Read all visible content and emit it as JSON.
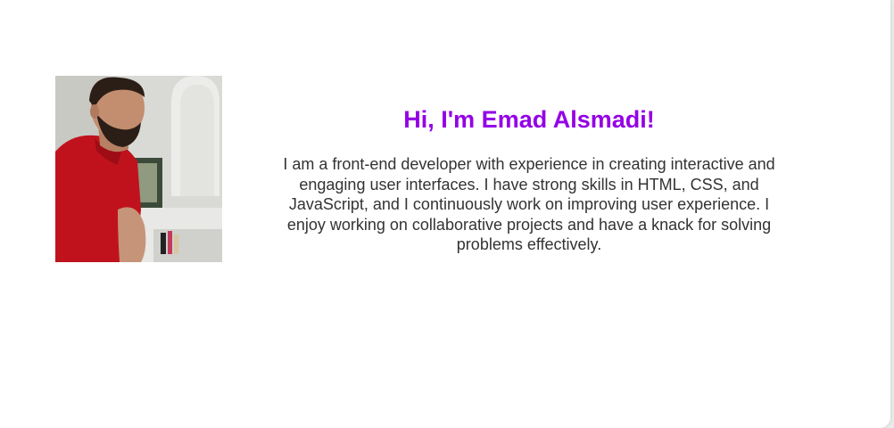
{
  "profile": {
    "photo_icon": "profile-photo",
    "greeting": "Hi, I'm Emad Alsmadi!",
    "bio": "I am a front-end developer with experience in creating interactive and engaging user interfaces. I have strong skills in HTML, CSS, and JavaScript, and I continuously work on improving user experience. I enjoy working on collaborative projects and have a knack for solving problems effectively."
  },
  "colors": {
    "page_background": "#ffffff",
    "outer_background": "#ebebeb",
    "heading": "#9400e6",
    "body_text": "#333333"
  }
}
